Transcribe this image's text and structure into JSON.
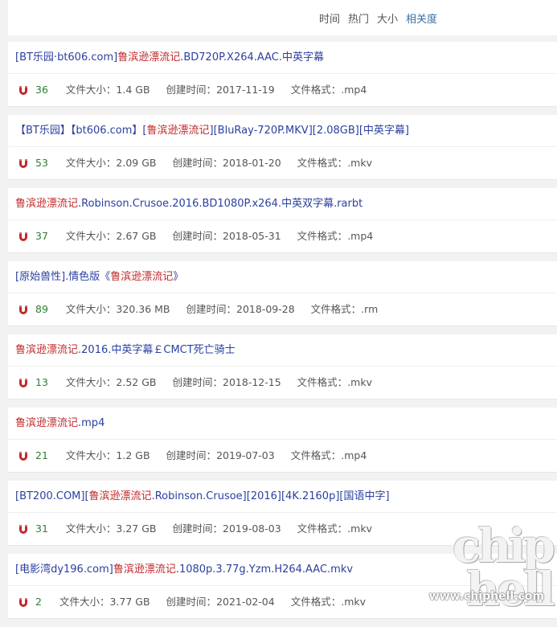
{
  "sort": {
    "options": [
      {
        "label": "时间",
        "active": false
      },
      {
        "label": "热门",
        "active": false
      },
      {
        "label": "大小",
        "active": false
      },
      {
        "label": "相关度",
        "active": true
      }
    ]
  },
  "labels": {
    "size": "文件大小：",
    "created": "创建时间：",
    "format": "文件格式："
  },
  "results": [
    {
      "title": [
        {
          "t": "[BT乐园·bt606.com]",
          "kw": false
        },
        {
          "t": "鲁滨逊漂流记",
          "kw": true
        },
        {
          "t": ".BD720P.X264.AAC.中英字幕",
          "kw": false
        }
      ],
      "count": "36",
      "size": "1.4 GB",
      "created": "2017-11-19",
      "format": ".mp4"
    },
    {
      "title": [
        {
          "t": "【BT乐园】【bt606.com】[",
          "kw": false
        },
        {
          "t": "鲁滨逊漂流记",
          "kw": true
        },
        {
          "t": "][BluRay-720P.MKV][2.08GB][中英字幕]",
          "kw": false
        }
      ],
      "count": "53",
      "size": "2.09 GB",
      "created": "2018-01-20",
      "format": ".mkv"
    },
    {
      "title": [
        {
          "t": "鲁滨逊漂流记",
          "kw": true
        },
        {
          "t": ".Robinson.Crusoe.2016.BD1080P.x264.中英双字幕.rarbt",
          "kw": false
        }
      ],
      "count": "37",
      "size": "2.67 GB",
      "created": "2018-05-31",
      "format": ".mp4"
    },
    {
      "title": [
        {
          "t": "[原始兽性].情色版《",
          "kw": false
        },
        {
          "t": "鲁滨逊漂流记",
          "kw": true
        },
        {
          "t": "》",
          "kw": false
        }
      ],
      "count": "89",
      "size": "320.36 MB",
      "created": "2018-09-28",
      "format": ".rm"
    },
    {
      "title": [
        {
          "t": "鲁滨逊漂流记",
          "kw": true
        },
        {
          "t": ".2016.中英字幕￡CMCT死亡骑士",
          "kw": false
        }
      ],
      "count": "13",
      "size": "2.52 GB",
      "created": "2018-12-15",
      "format": ".mkv"
    },
    {
      "title": [
        {
          "t": "鲁滨逊漂流记",
          "kw": true
        },
        {
          "t": ".mp4",
          "kw": false
        }
      ],
      "count": "21",
      "size": "1.2 GB",
      "created": "2019-07-03",
      "format": ".mp4"
    },
    {
      "title": [
        {
          "t": "[BT200.COM][",
          "kw": false
        },
        {
          "t": "鲁滨逊漂流记",
          "kw": true
        },
        {
          "t": ".Robinson.Crusoe][2016][4K.2160p][国语中字]",
          "kw": false
        }
      ],
      "count": "31",
      "size": "3.27 GB",
      "created": "2019-08-03",
      "format": ".mkv"
    },
    {
      "title": [
        {
          "t": "[电影湾dy196.com]",
          "kw": false
        },
        {
          "t": "鲁滨逊漂流记",
          "kw": true
        },
        {
          "t": ".1080p.3.77g.Yzm.H264.AAC.mkv",
          "kw": false
        }
      ],
      "count": "2",
      "size": "3.77 GB",
      "created": "2021-02-04",
      "format": ".mkv"
    }
  ],
  "watermark": {
    "logo": "chip\nhell",
    "url": "www.chiphell.com"
  },
  "colors": {
    "title_link": "#2a3fa0",
    "keyword": "#c0292b",
    "count": "#2f7d32",
    "magnet": "#c0292b",
    "sort_active": "#3b6ea8"
  },
  "icons": {
    "magnet": "magnet-icon"
  }
}
